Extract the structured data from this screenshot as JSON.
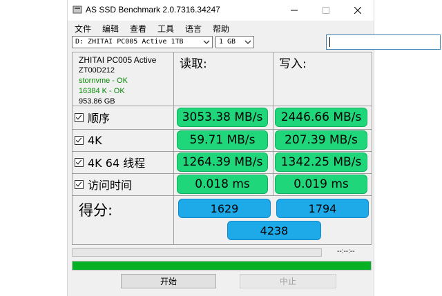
{
  "window": {
    "title": "AS SSD Benchmark 2.0.7316.34247"
  },
  "menu": [
    "文件",
    "编辑",
    "查看",
    "工具",
    "语言",
    "帮助"
  ],
  "drive_select": {
    "value": "D: ZHITAI PC005 Active 1TB"
  },
  "size_select": {
    "value": "1 GB"
  },
  "search": {
    "value": ""
  },
  "info": {
    "model": "ZHITAI PC005 Active",
    "firmware": "ZT00D212",
    "driver": "stornvme - OK",
    "alignment": "16384 K - OK",
    "capacity": "953.86 GB"
  },
  "columns": {
    "read": "读取:",
    "write": "写入:"
  },
  "tests": [
    {
      "label": "顺序",
      "read": "3053.38 MB/s",
      "write": "2446.66 MB/s"
    },
    {
      "label": "4K",
      "read": "59.71 MB/s",
      "write": "207.39 MB/s"
    },
    {
      "label": "4K 64 线程",
      "read": "1264.39 MB/s",
      "write": "1342.25 MB/s"
    },
    {
      "label": "访问时间",
      "read": "0.018 ms",
      "write": "0.019 ms"
    }
  ],
  "score": {
    "label": "得分:",
    "read": "1629",
    "write": "1794",
    "total": "4238"
  },
  "status": {
    "time": "--:--:--",
    "progress_fraction": 1.0
  },
  "buttons": {
    "start": "开始",
    "stop": "中止"
  },
  "colors": {
    "value_box": "#1fd67a",
    "score_box": "#1ea9e8",
    "progress": "#06b025"
  }
}
